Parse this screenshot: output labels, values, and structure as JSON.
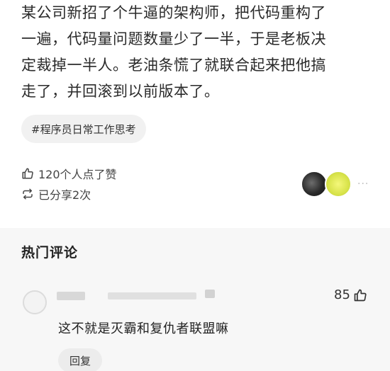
{
  "post": {
    "body": "某公司新招了个牛逼的架构师，把代码重构了\n一遍，代码量问题数量少了一半，于是老板决\n定裁掉一半人。老油条慌了就联合起来把他搞\n走了，并回滚到以前版本了。",
    "topic_tag": "#程序员日常工作思考",
    "likes_text": "120个人点了赞",
    "shares_text": "已分享2次",
    "more_dots": "···"
  },
  "comments": {
    "title": "热门评论",
    "items": [
      {
        "likes": "85",
        "text": "这不就是灭霸和复仇者联盟嘛",
        "reply_label": "回复"
      }
    ]
  }
}
